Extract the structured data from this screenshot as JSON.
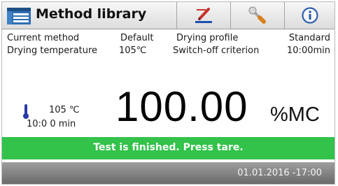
{
  "header": {
    "title": "Method library",
    "buttons": [
      {
        "name": "edit",
        "icon": "pen-icon"
      },
      {
        "name": "tools",
        "icon": "wrench-icon"
      },
      {
        "name": "info",
        "icon": "info-icon"
      }
    ]
  },
  "info": {
    "current_method_label": "Current method",
    "current_method_value": "Default",
    "drying_profile_label": "Drying profile",
    "drying_profile_value": "Standard",
    "drying_temperature_label": "Drying temperature",
    "drying_temperature_value": "105℃",
    "switch_off_label": "Switch-off criterion",
    "switch_off_value": "10:00min"
  },
  "status": {
    "temperature": "105 ℃",
    "time": "10:0 0 min",
    "thermometer_icon": "thermometer-icon"
  },
  "result": {
    "value": "100.00",
    "unit": "%MC"
  },
  "message": "Test is finished. Press tare.",
  "datetime": "01.01.2016 -17:00",
  "colors": {
    "status_green": "#33c24a",
    "footer_gray": "#7c7c7c",
    "thermo_blue": "#2b3aa8"
  }
}
